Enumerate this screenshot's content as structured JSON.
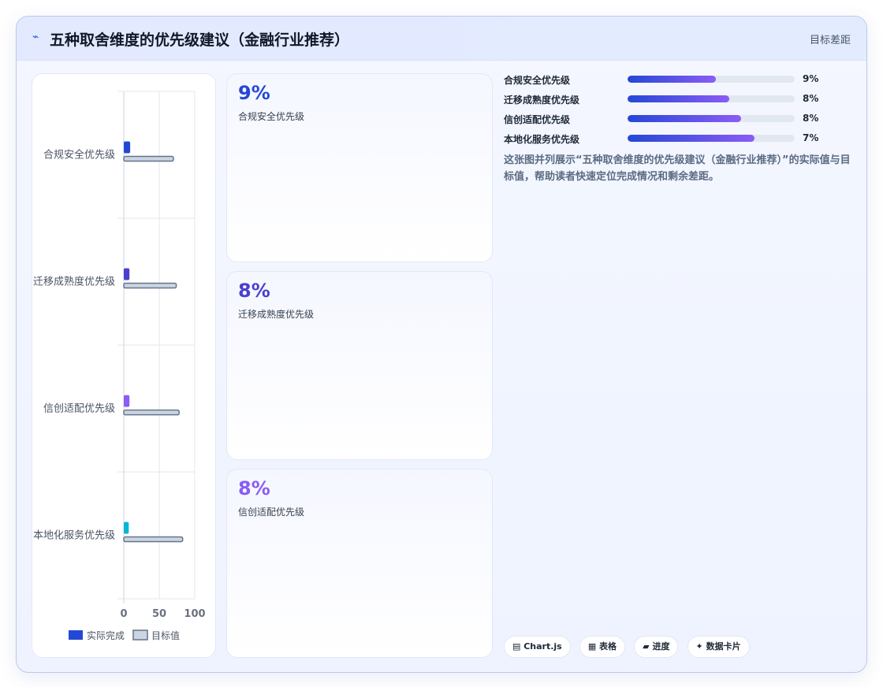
{
  "header": {
    "icon": "trend-icon",
    "title": "五种取舍维度的优先级建议（金融行业推荐）",
    "tag": "目标差距"
  },
  "kpis": [
    {
      "value": "9%",
      "label": "合规安全优先级",
      "color": "#2448d6"
    },
    {
      "value": "8%",
      "label": "迁移成熟度优先级",
      "color": "#4b3fd0"
    },
    {
      "value": "8%",
      "label": "信创适配优先级",
      "color": "#8b5cf6"
    }
  ],
  "progress": [
    {
      "label": "合规安全优先级",
      "value": "9%",
      "fraction": 0.53
    },
    {
      "label": "迁移成熟度优先级",
      "value": "8%",
      "fraction": 0.61
    },
    {
      "label": "信创适配优先级",
      "value": "8%",
      "fraction": 0.68
    },
    {
      "label": "本地化服务优先级",
      "value": "7%",
      "fraction": 0.76
    }
  ],
  "description": "这张图并列展示“五种取舍维度的优先级建议（金融行业推荐）”的实际值与目标值，帮助读者快速定位完成情况和剩余差距。",
  "chips": [
    {
      "icon": "chart-icon",
      "label": "▤ Chart.js"
    },
    {
      "icon": "table-icon",
      "label": "▦ 表格"
    },
    {
      "icon": "progress-icon",
      "label": "▰ 进度"
    },
    {
      "icon": "card-icon",
      "label": "✦ 数据卡片"
    }
  ],
  "chart_data": {
    "type": "bar",
    "orientation": "horizontal",
    "categories": [
      "合规安全优先级",
      "迁移成熟度优先级",
      "信创适配优先级",
      "本地化服务优先级"
    ],
    "category_labels_visible": [
      "合规安全优先级",
      "迁移成熟度优先级",
      "信创适配优先级",
      "本地化服务优先级"
    ],
    "series": [
      {
        "name": "实际完成",
        "values": [
          9,
          8,
          8,
          7
        ],
        "colors": [
          "#2448d6",
          "#4b3fd0",
          "#8b5cf6",
          "#06b6d4"
        ]
      },
      {
        "name": "目标值",
        "values": [
          70,
          74,
          78,
          83
        ],
        "color": "#cbd5e1",
        "border": "#64748b"
      }
    ],
    "xlim": [
      0,
      100
    ],
    "x_ticks": [
      "0",
      "50",
      "100"
    ],
    "grid": true,
    "legend": "bottom"
  }
}
